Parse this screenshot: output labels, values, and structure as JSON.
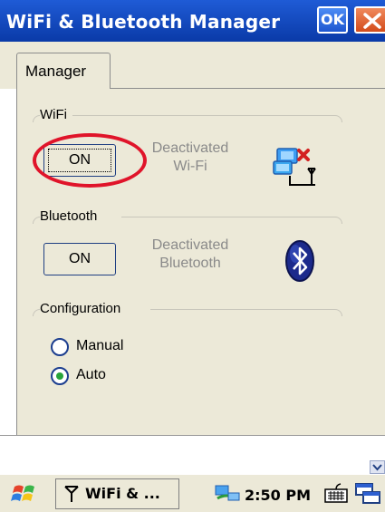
{
  "window": {
    "title": "WiFi & Bluetooth Manager",
    "ok_label": "OK"
  },
  "tabs": [
    {
      "label": "Manager",
      "selected": true
    }
  ],
  "wifi": {
    "group_label": "WiFi",
    "button_label": "ON",
    "status_line1": "Deactivated",
    "status_line2": "Wi-Fi",
    "icon": "wifi-network-disconnected-icon"
  },
  "bluetooth": {
    "group_label": "Bluetooth",
    "button_label": "ON",
    "status_line1": "Deactivated",
    "status_line2": "Bluetooth",
    "icon": "bluetooth-icon"
  },
  "configuration": {
    "group_label": "Configuration",
    "options": [
      {
        "label": "Manual",
        "checked": false
      },
      {
        "label": "Auto",
        "checked": true
      }
    ]
  },
  "taskbar": {
    "task_label": "WiFi & ...",
    "clock": "2:50 PM"
  },
  "colors": {
    "title_bar": "#0a3aa8",
    "panel": "#ece9d8",
    "highlight": "#e0142a",
    "radio_checked": "#28a43a"
  }
}
